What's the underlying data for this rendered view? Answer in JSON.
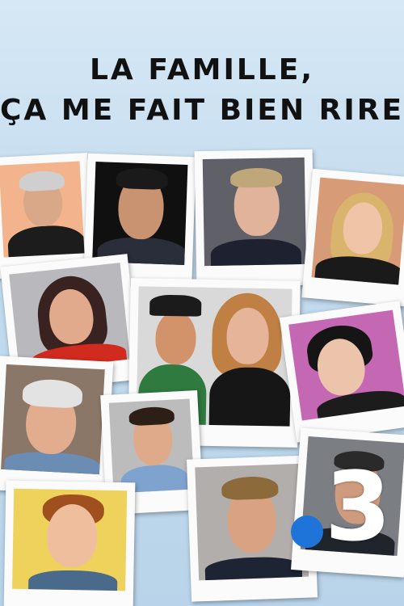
{
  "title": {
    "line1": "LA FAMILLE,",
    "line2": "ÇA ME FAIT BIEN RIRE !"
  },
  "channel_logo": {
    "number": "3",
    "dot_color": "#1f74d9"
  },
  "colors": {
    "background": "#c9dff0",
    "title": "#111111",
    "frame": "#fbfbfb"
  }
}
